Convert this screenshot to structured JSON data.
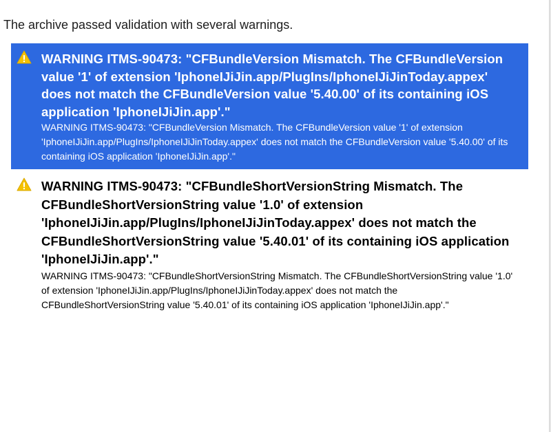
{
  "summary_text": "The archive passed validation with several warnings.",
  "icons": {
    "warning": "warning-triangle-icon",
    "warning_color": "#f5c200"
  },
  "colors": {
    "selection_background": "#2d69e0"
  },
  "issues": [
    {
      "selected": true,
      "title": "WARNING ITMS-90473: \"CFBundleVersion Mismatch. The CFBundleVersion value '1' of extension 'IphoneIJiJin.app/PlugIns/IphoneIJiJinToday.appex' does not match the CFBundleVersion value '5.40.00' of its containing iOS application 'IphoneIJiJin.app'.\"",
      "detail": "WARNING ITMS-90473: \"CFBundleVersion Mismatch. The CFBundleVersion value '1' of extension 'IphoneIJiJin.app/PlugIns/IphoneIJiJinToday.appex' does not match the CFBundleVersion value '5.40.00' of its containing iOS application 'IphoneIJiJin.app'.\""
    },
    {
      "selected": false,
      "title": "WARNING ITMS-90473: \"CFBundleShortVersionString Mismatch. The CFBundleShortVersionString value '1.0' of extension 'IphoneIJiJin.app/PlugIns/IphoneIJiJinToday.appex' does not match the CFBundleShortVersionString value '5.40.01' of its containing iOS application 'IphoneIJiJin.app'.\"",
      "detail": "WARNING ITMS-90473: \"CFBundleShortVersionString Mismatch. The CFBundleShortVersionString value '1.0' of extension 'IphoneIJiJin.app/PlugIns/IphoneIJiJinToday.appex' does not match the CFBundleShortVersionString value '5.40.01' of its containing iOS application 'IphoneIJiJin.app'.\""
    }
  ]
}
